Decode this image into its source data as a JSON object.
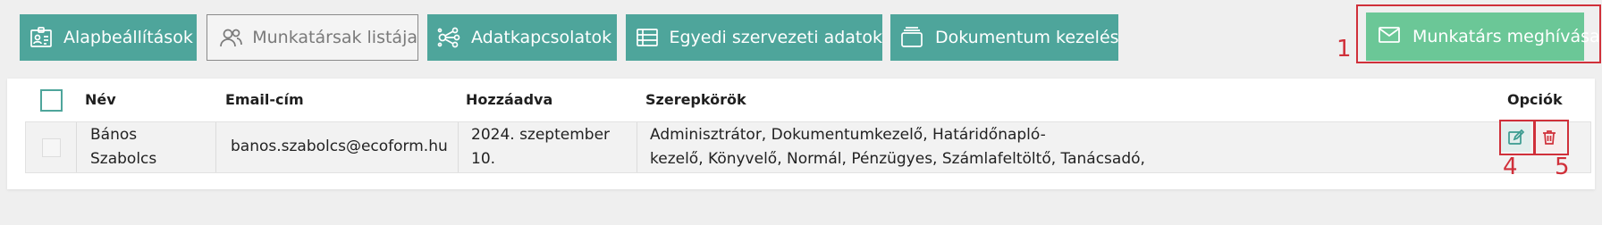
{
  "tabs": [
    {
      "label": "Alapbeállítások",
      "icon": "id-card-icon",
      "active": false
    },
    {
      "label": "Munkatársak listája",
      "icon": "users-icon",
      "active": true
    },
    {
      "label": "Adatkapcsolatok",
      "icon": "network-icon",
      "active": false
    },
    {
      "label": "Egyedi szervezeti adatok",
      "icon": "table-icon",
      "active": false
    },
    {
      "label": "Dokumentum kezelés",
      "icon": "documents-icon",
      "active": false
    }
  ],
  "invite_button": {
    "label": "Munkatárs meghívása",
    "icon": "mail-icon"
  },
  "annotations": {
    "invite": "1",
    "edit": "4",
    "delete": "5"
  },
  "table": {
    "columns": {
      "name": "Név",
      "email": "Email-cím",
      "added": "Hozzáadva",
      "roles": "Szerepkörök",
      "options": "Opciók"
    },
    "rows": [
      {
        "name_line1": "Bános",
        "name_line2": "Szabolcs",
        "email": "banos.szabolcs@ecoform.hu",
        "added_line1": "2024. szeptember",
        "added_line2": "10.",
        "roles_line1": "Adminisztrátor, Dokumentumkezelő, Határidőnapló-",
        "roles_line2": "kezelő, Könyvelő, Normál, Pénzügyes, Számlafeltöltő, Tanácsadó,"
      }
    ]
  },
  "colors": {
    "accent": "#4ea59b",
    "invite": "#6bc797",
    "annotation": "#d0303a",
    "background": "#efefef"
  }
}
